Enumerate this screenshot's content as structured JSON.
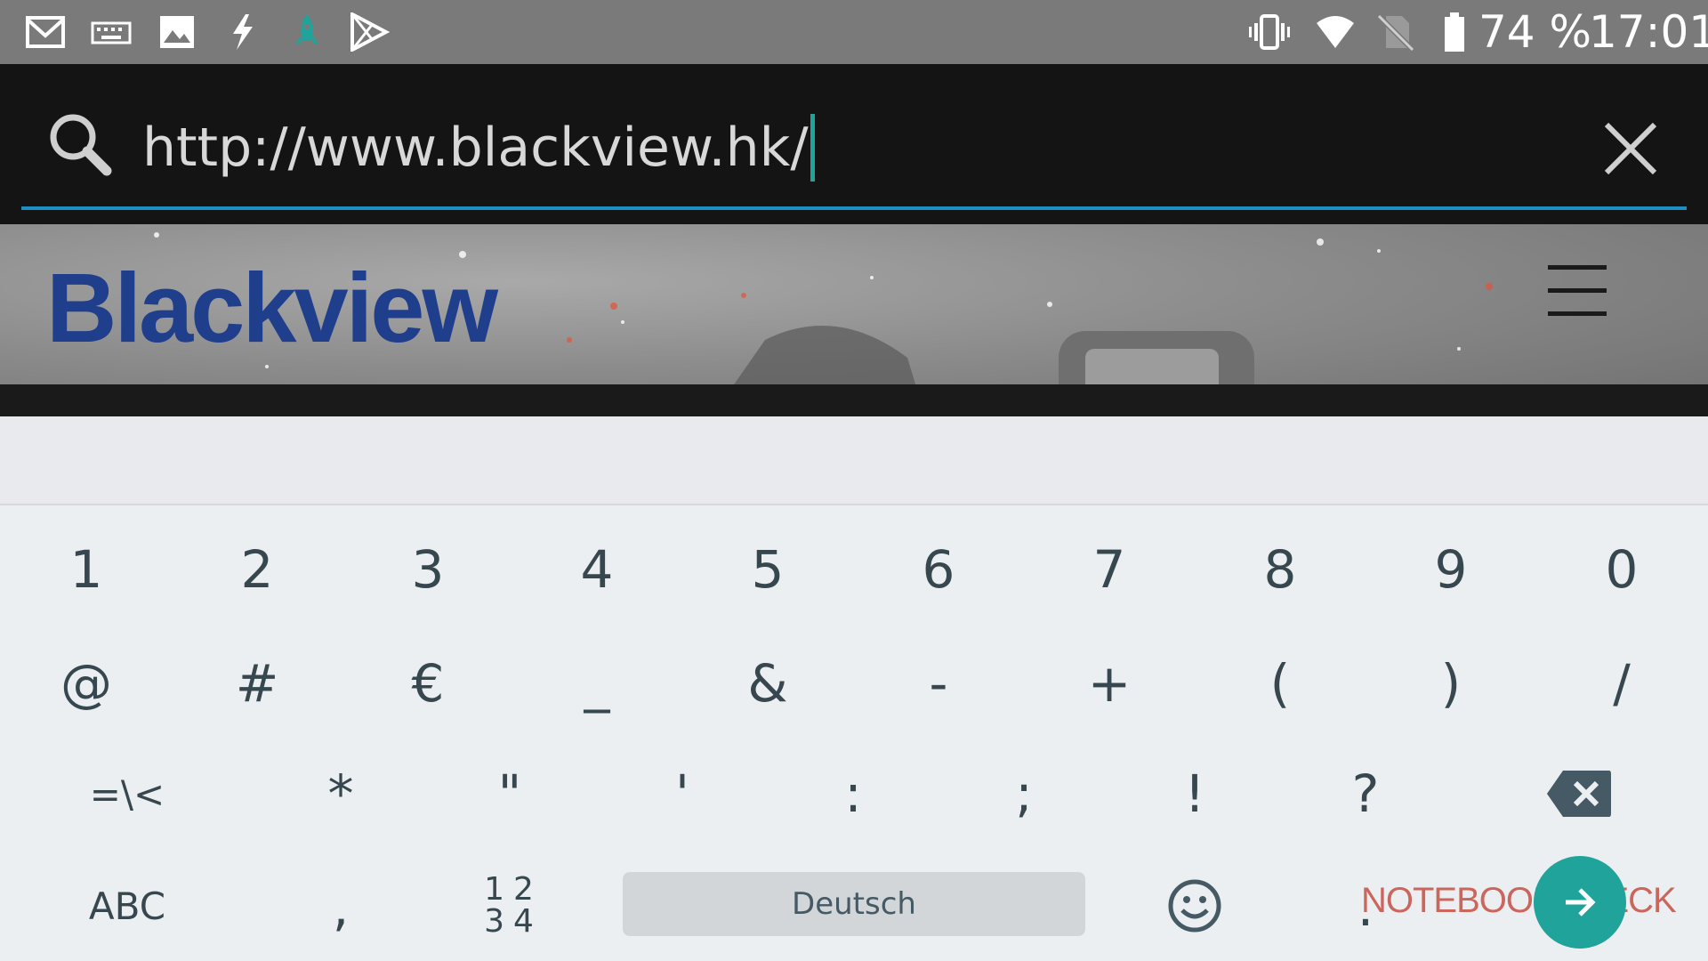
{
  "status_bar": {
    "icons_left": [
      "gmail-icon",
      "keyboard-icon",
      "gallery-icon",
      "flash-icon",
      "rocket-icon",
      "play-store-icon"
    ],
    "icons_right": [
      "vibrate-icon",
      "wifi-icon",
      "no-sim-icon",
      "battery-icon"
    ],
    "battery": "74 %",
    "time": "17:01"
  },
  "url_bar": {
    "url": "http://www.blackview.hk/",
    "accent_color": "#1e8fc4",
    "caret_color": "#1fa39a"
  },
  "webpage": {
    "logo_text": "Blackview",
    "logo_color": "#1f3f8c",
    "menu_icon": "hamburger-icon"
  },
  "keyboard": {
    "row1": [
      "1",
      "2",
      "3",
      "4",
      "5",
      "6",
      "7",
      "8",
      "9",
      "0"
    ],
    "row2": [
      "@",
      "#",
      "€",
      "_",
      "&",
      "-",
      "+",
      "(",
      ")",
      "/"
    ],
    "row3": [
      "=\\<",
      "*",
      "\"",
      "'",
      ":",
      ";",
      "!",
      "?"
    ],
    "row4": {
      "abc": "ABC",
      "comma": ",",
      "numpad_top": "12",
      "numpad_bottom": "34",
      "space": "Deutsch",
      "period": ".",
      "enter_color": "#1fa39a"
    }
  },
  "watermark": "NOTEBOOKCHECK"
}
